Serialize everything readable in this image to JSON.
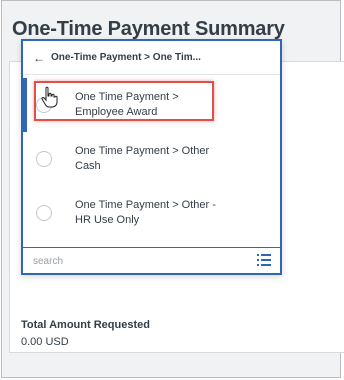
{
  "page": {
    "title": "One-Time Payment Summary",
    "total_label": "Total Amount Requested",
    "total_value": "0.00 USD"
  },
  "dropdown": {
    "breadcrumb": "One-Time Payment > One Tim...",
    "back_icon": "back-arrow-icon",
    "options": [
      {
        "label_line1": "One Time Payment >",
        "label_line2": "Employee Award"
      },
      {
        "label_line1": "One Time Payment > Other",
        "label_line2": "Cash"
      },
      {
        "label_line1": "One Time Payment > Other -",
        "label_line2": "HR Use Only"
      }
    ],
    "search_placeholder": "search",
    "list_icon": "list-icon"
  },
  "colors": {
    "accent": "#2f67b7",
    "highlight": "#e0504b",
    "text": "#333e48"
  }
}
